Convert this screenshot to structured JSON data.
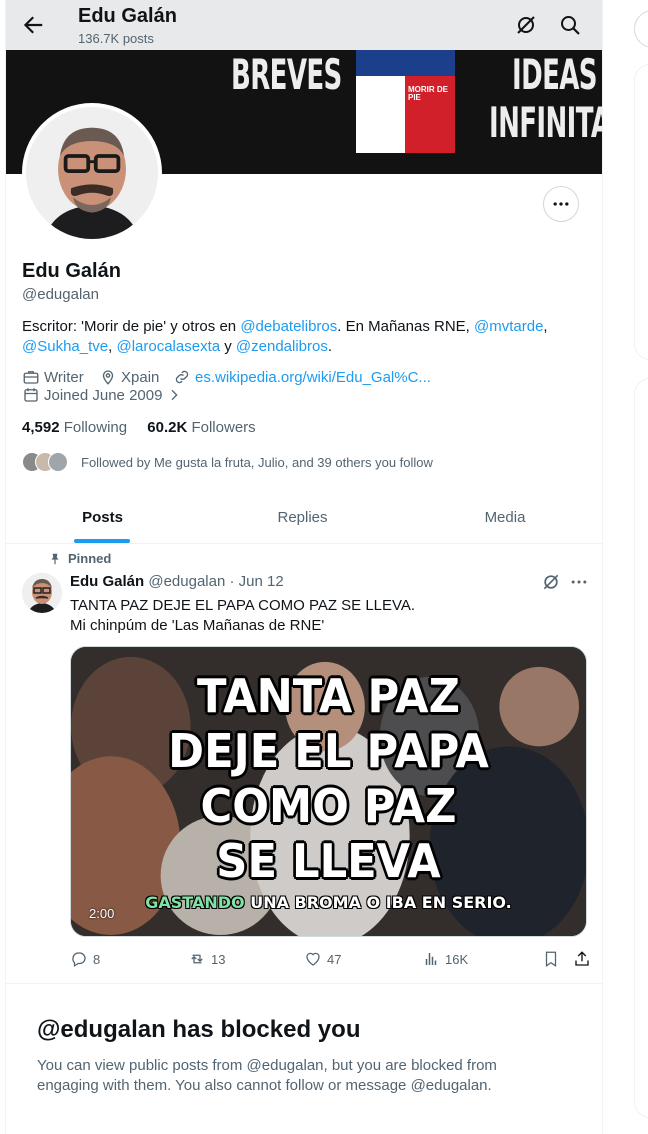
{
  "header": {
    "name": "Edu Galán",
    "post_count": "136.7K posts"
  },
  "banner": {
    "word_left": "BREVES",
    "word_right_1": "IDEAS",
    "word_right_2": "INFINITAS",
    "book_title": "MORIR DE PIE",
    "colors": {
      "background": "#121212",
      "book_blue": "#1c3f8c",
      "book_red": "#d2202a"
    }
  },
  "profile": {
    "name": "Edu Galán",
    "handle": "@edugalan",
    "bio": {
      "prefix": "Escritor: 'Morir de pie'  y otros en ",
      "mention1": "@debatelibros",
      "mid1": ". En Mañanas RNE, ",
      "mention2": "@mvtarde",
      "mid2": ", ",
      "mention3": "@Sukha_tve",
      "mid3": ", ",
      "mention4": "@larocalasexta",
      "mid4": " y ",
      "mention5": "@zendalibros",
      "suffix": "."
    },
    "occupation": "Writer",
    "location": "Xpain",
    "website": "es.wikipedia.org/wiki/Edu_Gal%C...",
    "joined": "Joined June 2009",
    "following_count": "4,592",
    "following_label": "Following",
    "followers_count": "60.2K",
    "followers_label": "Followers",
    "followed_by": "Followed by Me gusta la fruta, Julio, and 39 others you follow"
  },
  "tabs": [
    {
      "label": "Posts",
      "active": true
    },
    {
      "label": "Replies",
      "active": false
    },
    {
      "label": "Media",
      "active": false
    }
  ],
  "tweet": {
    "pinned_label": "Pinned",
    "author_name": "Edu Galán",
    "author_handle": "@edugalan",
    "separator": "·",
    "date": "Jun 12",
    "text_line1": "TANTA PAZ DEJE EL PAPA COMO PAZ SE LLEVA.",
    "text_line2": "Mi chinpúm de 'Las Mañanas de RNE'",
    "media": {
      "overlay_lines": [
        "TANTA PAZ",
        "DEJE EL PAPA",
        "COMO PAZ",
        "SE LLEVA"
      ],
      "subtitle_highlight": "GASTANDO",
      "subtitle_rest": " UNA BROMA O IBA EN SERIO.",
      "duration": "2:00"
    },
    "stats": {
      "replies": "8",
      "reposts": "13",
      "likes": "47",
      "views": "16K"
    }
  },
  "blocked": {
    "title": "@edugalan has blocked you",
    "text": "You can view public posts from @edugalan, but you are blocked from engaging with them. You also cannot follow or message @edugalan."
  },
  "colors": {
    "accent": "#1d9bf0",
    "secondary_text": "#536471",
    "primary_text": "#0f1419"
  }
}
